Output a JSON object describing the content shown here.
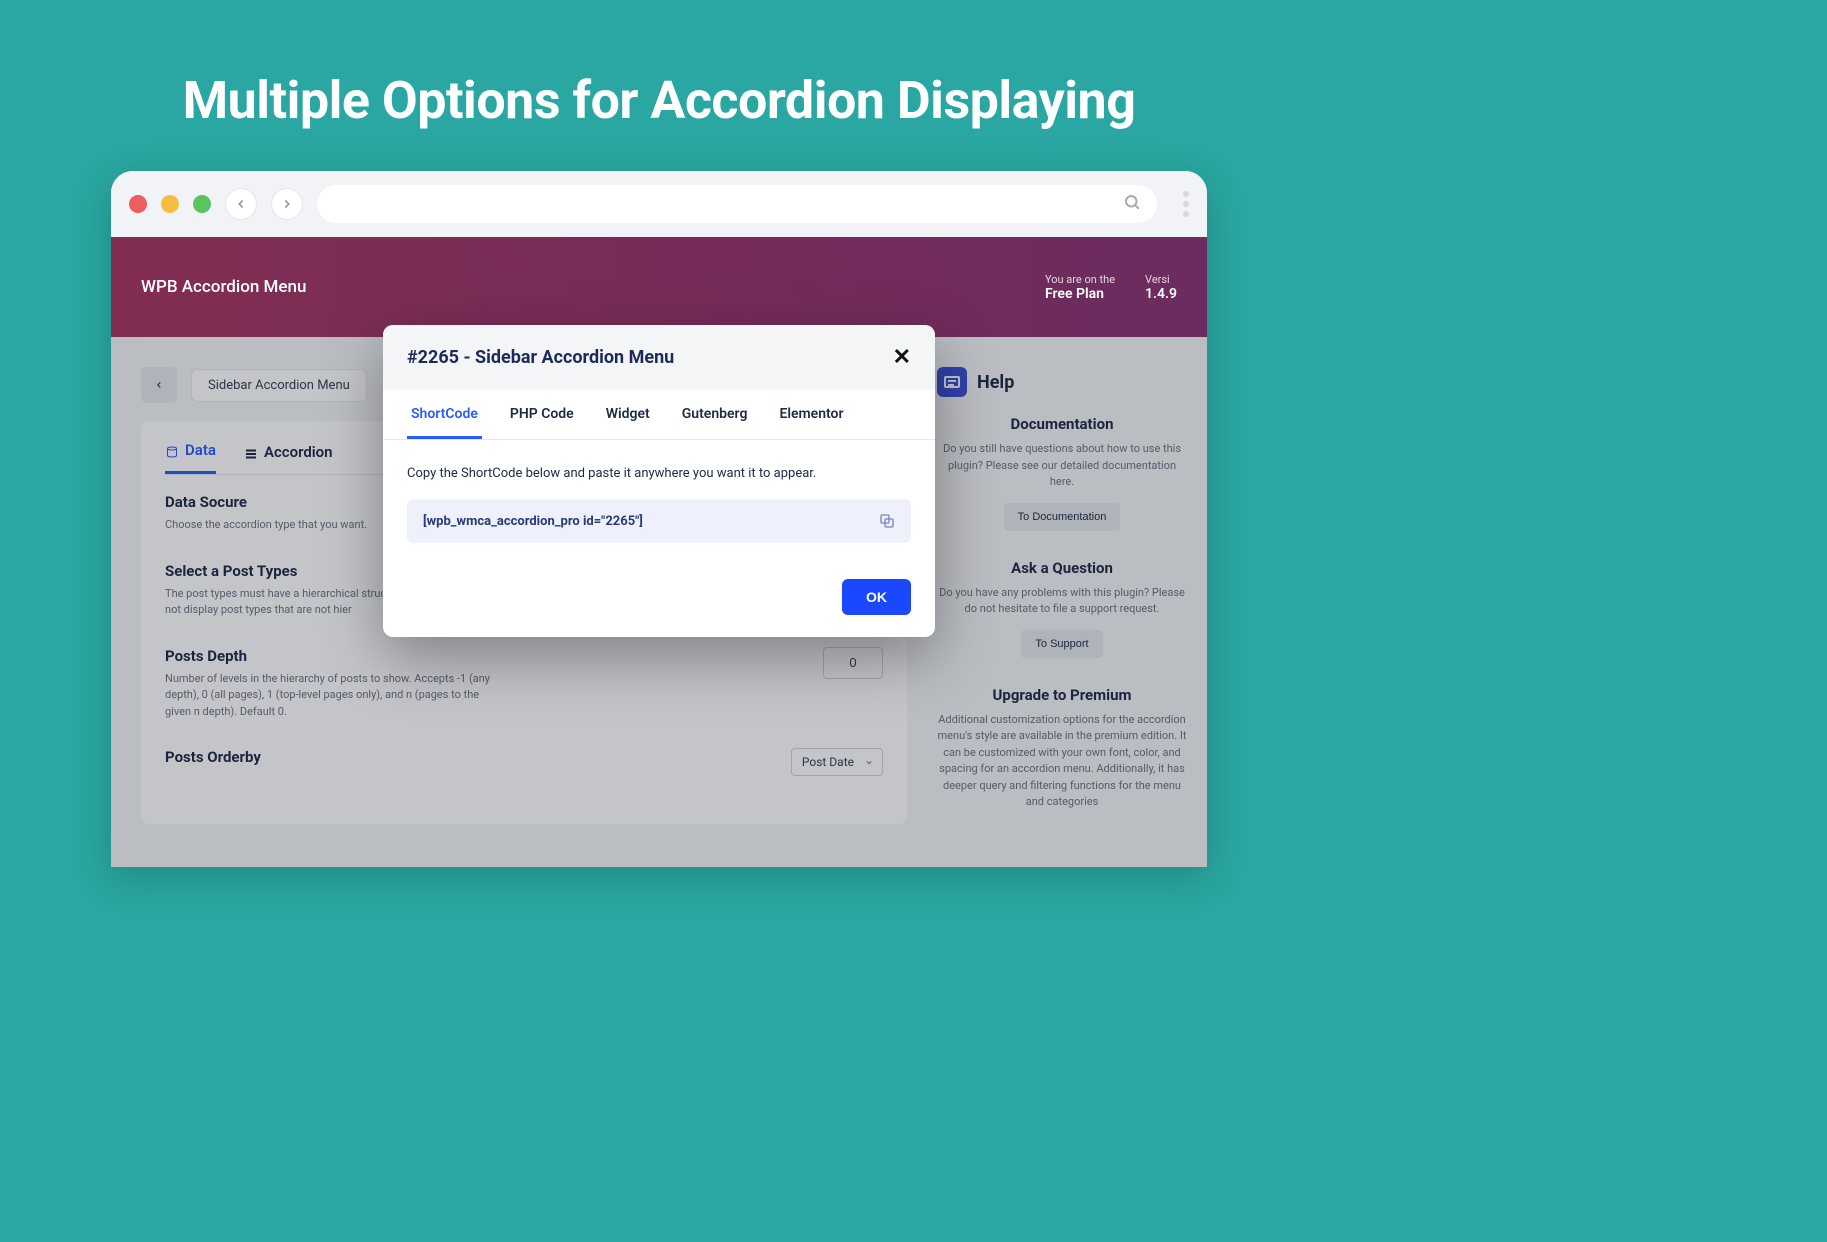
{
  "hero": {
    "title": "Multiple Options for Accordion Displaying"
  },
  "app": {
    "title": "WPB Accordion Menu",
    "plan_label": "You are on the",
    "plan_value": "Free Plan",
    "version_label": "Versi",
    "version_value": "1.4.9"
  },
  "breadcrumb": {
    "item": "Sidebar Accordion Menu"
  },
  "inner_tabs": [
    {
      "label": "Data",
      "active": true
    },
    {
      "label": "Accordion",
      "active": false
    }
  ],
  "fields": {
    "data_source": {
      "title": "Data Socure",
      "desc": "Choose the accordion type that you want."
    },
    "post_types": {
      "title": "Select a Post Types",
      "desc": "The post types must have a hierarchical structure. The accordion will not display post types that are not hier"
    },
    "depth": {
      "title": "Posts Depth",
      "desc": "Number of levels in the hierarchy of posts to show. Accepts -1 (any depth), 0 (all pages), 1 (top-level pages only), and n (pages to the given n depth). Default 0.",
      "value": "0"
    },
    "orderby": {
      "title": "Posts Orderby",
      "value": "Post Date"
    }
  },
  "help": {
    "heading": "Help",
    "doc": {
      "title": "Documentation",
      "desc": "Do you still have questions about how to use this plugin? Please see our detailed documentation here.",
      "btn": "To Documentation"
    },
    "ask": {
      "title": "Ask a Question",
      "desc": "Do you have any problems with this plugin? Please do not hesitate to file a support request.",
      "btn": "To Support"
    },
    "upgrade": {
      "title": "Upgrade to Premium",
      "desc": "Additional customization options for the accordion menu's style are available in the premium edition. It can be customized with your own font, color, and spacing for an accordion menu. Additionally, it has deeper query and filtering functions for the menu and categories"
    }
  },
  "modal": {
    "title": "#2265 - Sidebar Accordion Menu",
    "tabs": [
      "ShortCode",
      "PHP Code",
      "Widget",
      "Gutenberg",
      "Elementor"
    ],
    "active_tab": "ShortCode",
    "instruction": "Copy the ShortCode below and paste it anywhere you want it to appear.",
    "code": "[wpb_wmca_accordion_pro id=\"2265\"]",
    "ok": "OK"
  }
}
